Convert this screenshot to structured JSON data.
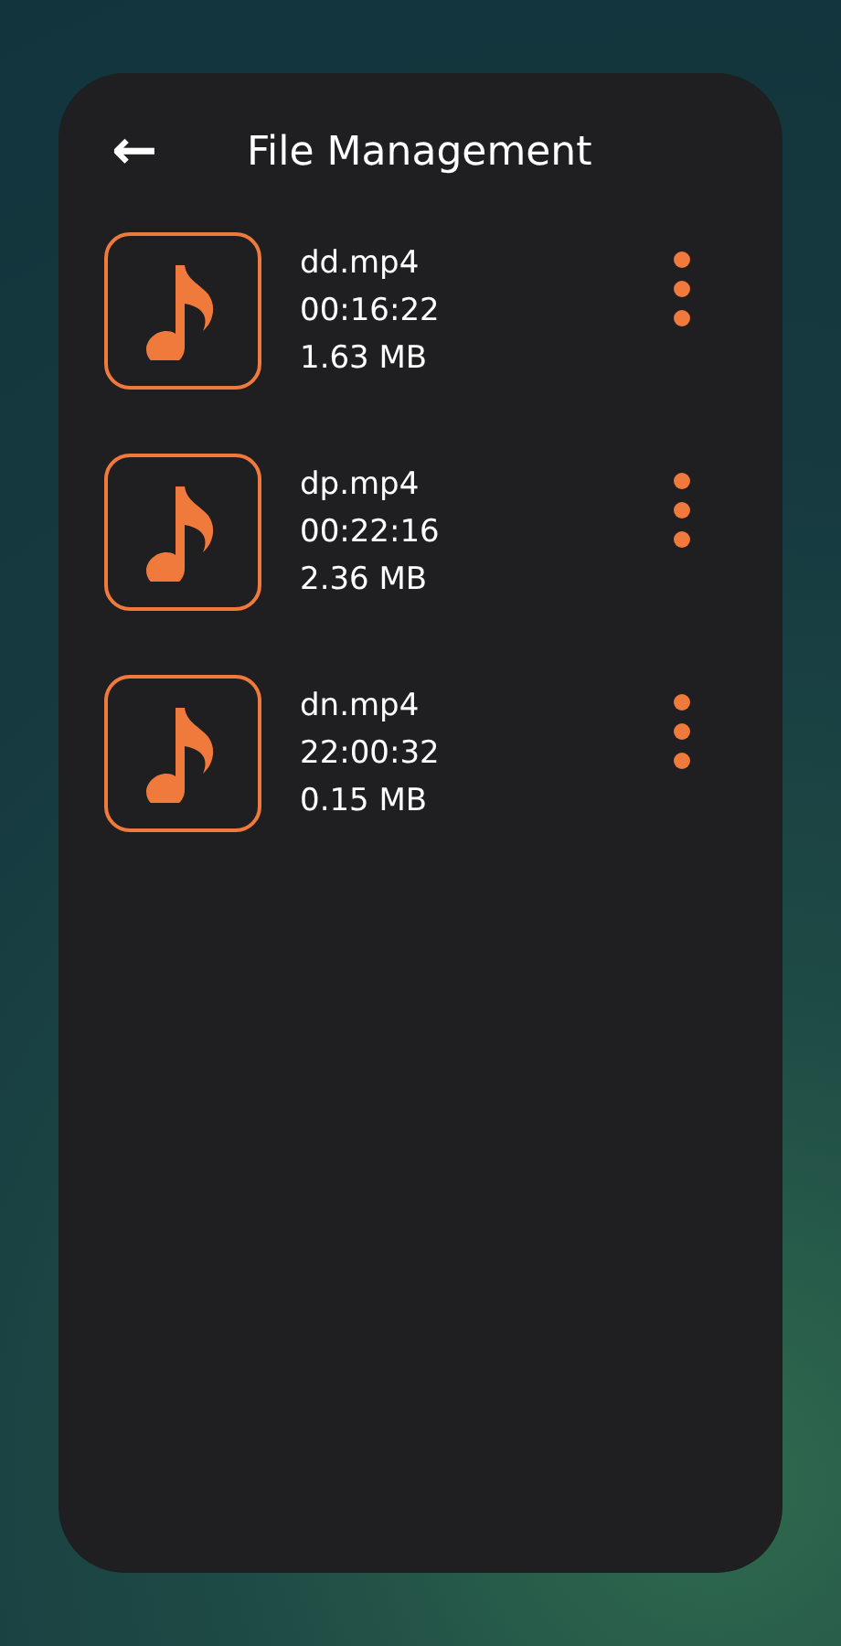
{
  "header": {
    "back_icon": "←",
    "title": "File Management"
  },
  "files": [
    {
      "name": "dd.mp4",
      "duration": "00:16:22",
      "size": "1.63 MB"
    },
    {
      "name": "dp.mp4",
      "duration": "00:22:16",
      "size": "2.36 MB"
    },
    {
      "name": "dn.mp4",
      "duration": "22:00:32",
      "size": "0.15 MB"
    }
  ]
}
